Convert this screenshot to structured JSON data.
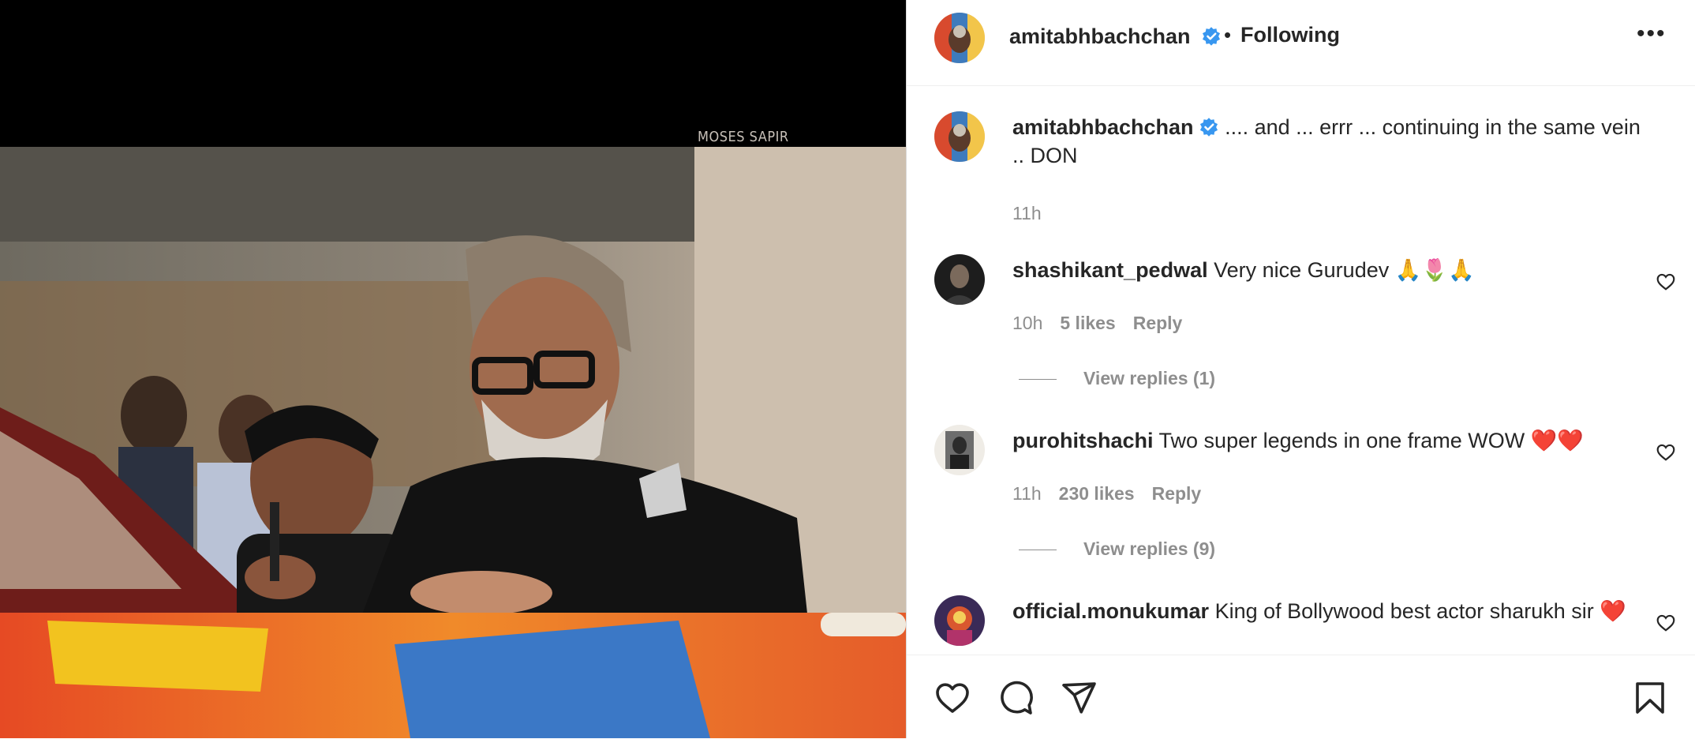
{
  "post": {
    "username": "amitabhbachchan",
    "separator": "•",
    "follow_status": "Following",
    "more_label": "•••",
    "watermark": "MOSES SAPIR"
  },
  "caption": {
    "username": "amitabhbachchan",
    "text": ".... and ... errr ... continuing in the same vein .. DON",
    "time": "11h"
  },
  "comments": [
    {
      "username": "shashikant_pedwal",
      "text": "Very nice Gurudev 🙏🌷🙏",
      "time": "10h",
      "likes": "5 likes",
      "reply_label": "Reply",
      "view_replies": "View replies (1)"
    },
    {
      "username": "purohitshachi",
      "text": "Two super legends in one frame WOW ❤️❤️",
      "time": "11h",
      "likes": "230 likes",
      "reply_label": "Reply",
      "view_replies": "View replies (9)"
    },
    {
      "username": "official.monukumar",
      "text": "King of Bollywood best actor sharukh sir ❤️"
    }
  ],
  "icons": {
    "like": "heart-icon",
    "comment": "comment-icon",
    "share": "share-icon",
    "save": "bookmark-icon",
    "verified": "verified-badge-icon",
    "comment_like": "heart-icon"
  },
  "colors": {
    "verified": "#3897f0",
    "muted": "#8e8e8e",
    "text": "#262626"
  }
}
